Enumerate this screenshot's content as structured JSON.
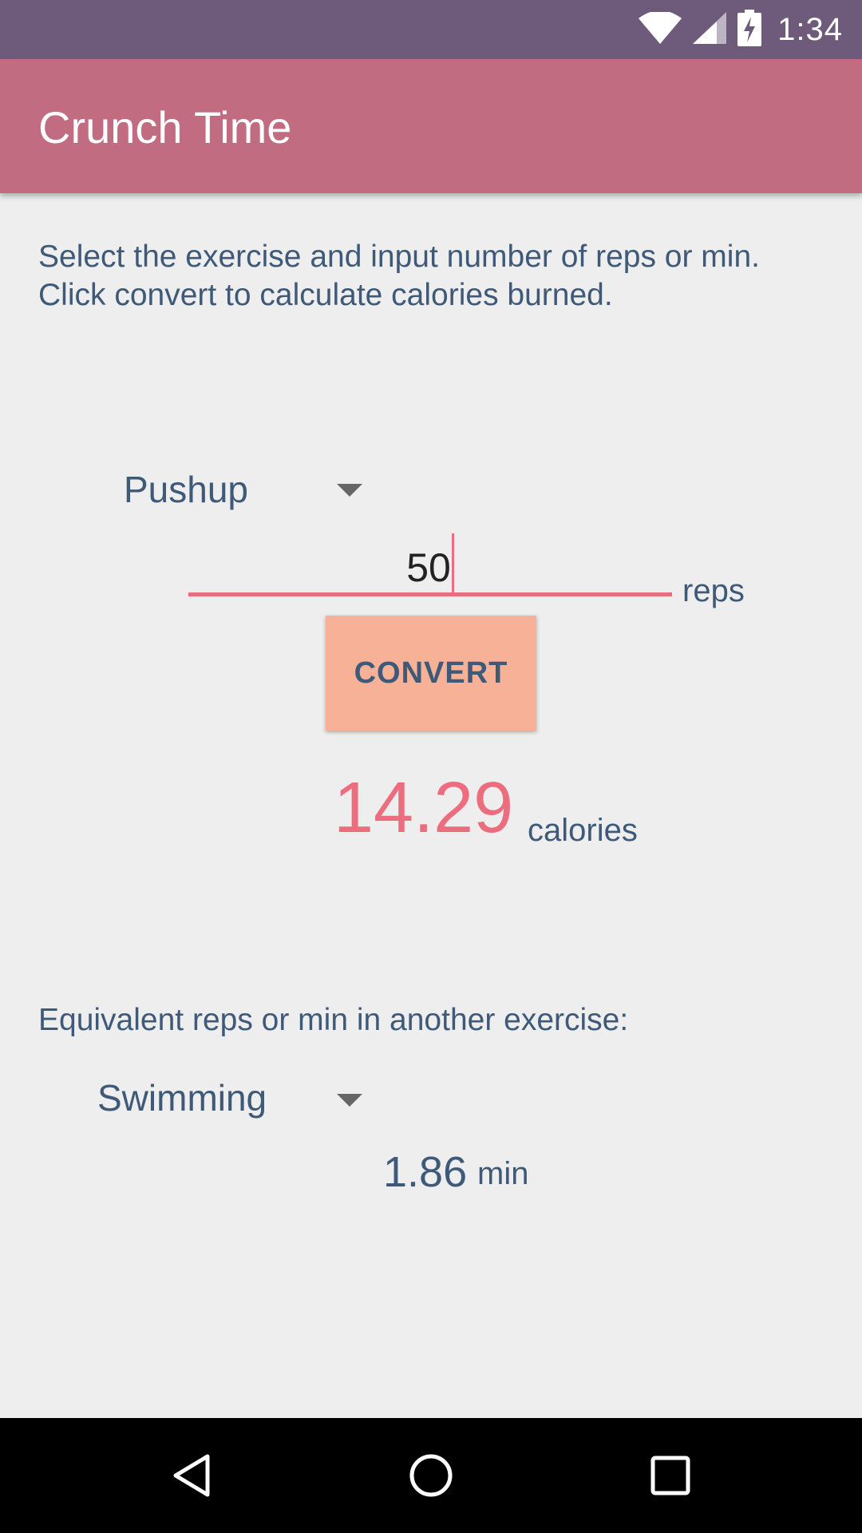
{
  "status_bar": {
    "time": "1:34",
    "icons": [
      "wifi-icon",
      "cell-signal-icon",
      "battery-charging-icon"
    ]
  },
  "app_bar": {
    "title": "Crunch Time",
    "color": "#c16c81"
  },
  "instructions": {
    "line1": "Select the exercise and input number of reps or min.",
    "line2": "Click convert to calculate calories burned."
  },
  "exercise_select": {
    "selected": "Pushup"
  },
  "reps_input": {
    "value": "50",
    "unit": "reps"
  },
  "convert_button": {
    "label": "CONVERT",
    "color": "#f7b197"
  },
  "result": {
    "calories": "14.29",
    "unit": "calories",
    "color": "#ec6d7d"
  },
  "equivalent": {
    "label": "Equivalent reps or min in another exercise:",
    "selected": "Swimming",
    "value": "1.86",
    "unit": "min"
  },
  "nav_bar": {
    "buttons": [
      "back-icon",
      "home-icon",
      "recents-icon"
    ]
  }
}
